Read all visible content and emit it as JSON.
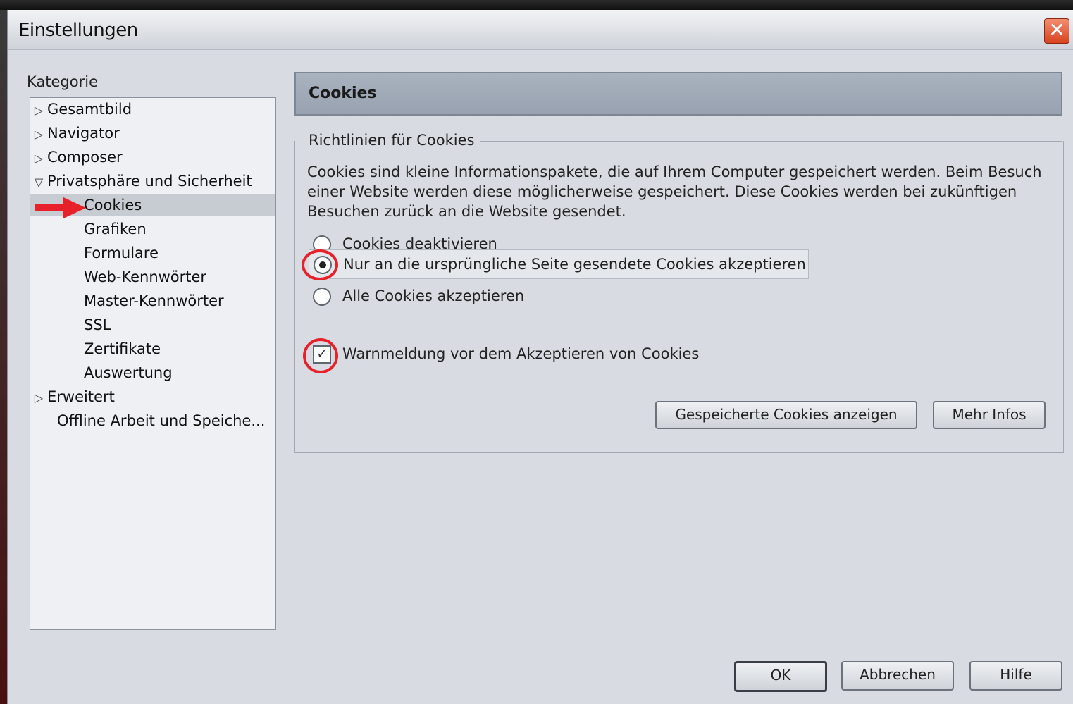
{
  "window": {
    "title": "Einstellungen",
    "close_icon": "close-icon",
    "close_glyph": "✕"
  },
  "sidebar": {
    "label": "Kategorie",
    "items": [
      {
        "label": "Gesamtbild",
        "arrow": "▷"
      },
      {
        "label": "Navigator",
        "arrow": "▷"
      },
      {
        "label": "Composer",
        "arrow": "▷"
      },
      {
        "label": "Privatsphäre und Sicherheit",
        "arrow": "▽"
      },
      {
        "label": "Cookies",
        "arrow": ""
      },
      {
        "label": "Grafiken",
        "arrow": ""
      },
      {
        "label": "Formulare",
        "arrow": ""
      },
      {
        "label": "Web-Kennwörter",
        "arrow": ""
      },
      {
        "label": "Master-Kennwörter",
        "arrow": ""
      },
      {
        "label": "SSL",
        "arrow": ""
      },
      {
        "label": "Zertifikate",
        "arrow": ""
      },
      {
        "label": "Auswertung",
        "arrow": ""
      },
      {
        "label": "Erweitert",
        "arrow": "▷"
      },
      {
        "label": "Offline Arbeit und Speiche...",
        "arrow": ""
      }
    ],
    "selected": "Cookies"
  },
  "panel": {
    "title": "Cookies",
    "group_label": "Richtlinien für Cookies",
    "description": "Cookies sind kleine Informationspakete, die auf Ihrem Computer gespeichert werden. Beim Besuch einer Website werden diese möglicherweise gespeichert. Diese Cookies werden bei zukünftigen Besuchen zurück an die Website gesendet.",
    "options": [
      {
        "label": "Cookies deaktivieren",
        "checked": false
      },
      {
        "label": "Nur an die ursprüngliche Seite gesendete Cookies akzeptieren",
        "checked": true
      },
      {
        "label": "Alle Cookies akzeptieren",
        "checked": false
      }
    ],
    "warn_checkbox": {
      "label": "Warnmeldung vor dem Akzeptieren von Cookies",
      "checked": true,
      "mark": "✓"
    },
    "buttons": {
      "show_cookies": "Gespeicherte Cookies anzeigen",
      "more_info": "Mehr Infos"
    }
  },
  "footer": {
    "ok": "OK",
    "cancel": "Abbrechen",
    "help": "Hilfe"
  },
  "colors": {
    "annotation": "#e8202a",
    "header_bg": "#a9b2bf",
    "window_bg": "#d8dbe1"
  }
}
